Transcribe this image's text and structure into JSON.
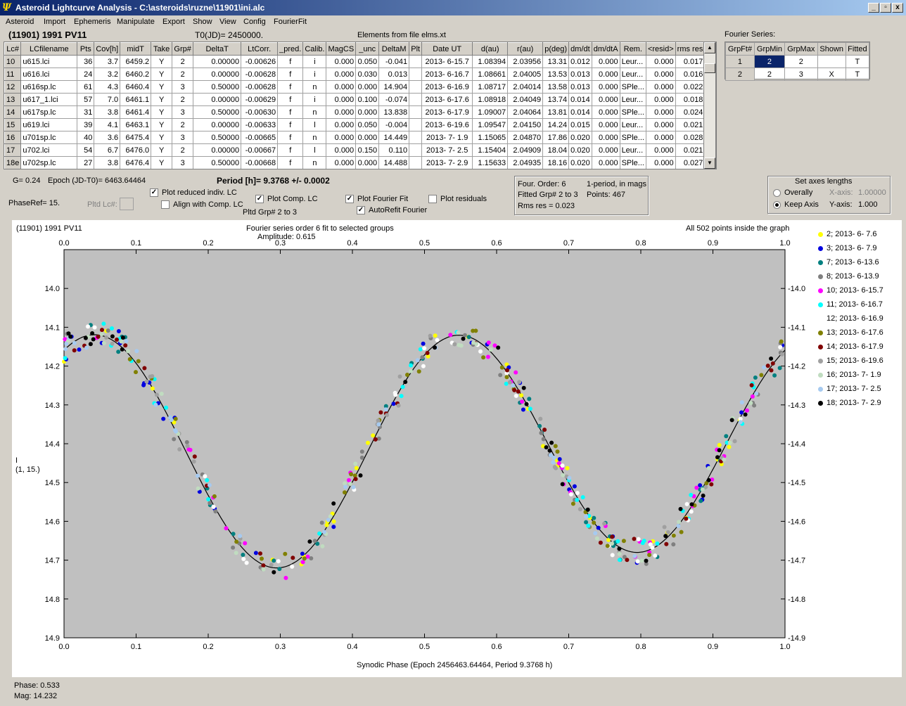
{
  "window": {
    "title": "Asteroid Lightcurve Analysis - C:\\asteroids\\ruzne\\11901\\ini.alc",
    "min": "_",
    "max": "▫",
    "close": "x"
  },
  "menu": [
    "Asteroid",
    "Import",
    "Ephemeris",
    "Manipulate",
    "Export",
    "Show",
    "View",
    "Config",
    "FourierFit"
  ],
  "header": {
    "object": "(11901) 1991 PV11",
    "t0": "T0(JD)= 2450000.",
    "elements": "Elements from file elms.xt"
  },
  "grid": {
    "columns": [
      "Lc#",
      "LCfilename",
      "Pts",
      "Cov[h]",
      "midT",
      "Take",
      "Grp#",
      "DeltaT",
      "LtCorr.",
      "_pred.",
      "Calib.",
      "MagCS",
      "_unc",
      "DeltaM",
      "Plt",
      "Date UT",
      "d(au)",
      "r(au)",
      "p(deg)",
      "dm/dt",
      "dm/dtA",
      "Rem.",
      "<resid>",
      "rms res"
    ],
    "rows": [
      [
        "10",
        "u615.lci",
        "36",
        "3.7",
        "6459.2",
        "Y",
        "2",
        "0.00000",
        "-0.00626",
        "f",
        "i",
        "0.000",
        "0.050",
        "-0.041",
        "",
        "2013- 6-15.7",
        "1.08394",
        "2.03956",
        "13.31",
        "0.012",
        "0.000",
        "Leur...",
        "0.000",
        "0.017"
      ],
      [
        "11",
        "u616.lci",
        "24",
        "3.2",
        "6460.2",
        "Y",
        "2",
        "0.00000",
        "-0.00628",
        "f",
        "i",
        "0.000",
        "0.030",
        "0.013",
        "",
        "2013- 6-16.7",
        "1.08661",
        "2.04005",
        "13.53",
        "0.013",
        "0.000",
        "Leur...",
        "0.000",
        "0.016"
      ],
      [
        "12",
        "u616sp.lc",
        "61",
        "4.3",
        "6460.4",
        "Y",
        "3",
        "0.50000",
        "-0.00628",
        "f",
        "n",
        "0.000",
        "0.000",
        "14.904",
        "",
        "2013- 6-16.9",
        "1.08717",
        "2.04014",
        "13.58",
        "0.013",
        "0.000",
        "SPle...",
        "0.000",
        "0.022"
      ],
      [
        "13",
        "u617_1.lci",
        "57",
        "7.0",
        "6461.1",
        "Y",
        "2",
        "0.00000",
        "-0.00629",
        "f",
        "i",
        "0.000",
        "0.100",
        "-0.074",
        "",
        "2013- 6-17.6",
        "1.08918",
        "2.04049",
        "13.74",
        "0.014",
        "0.000",
        "Leur...",
        "0.000",
        "0.018"
      ],
      [
        "14",
        "u617sp.lc",
        "31",
        "3.8",
        "6461.4",
        "Y",
        "3",
        "0.50000",
        "-0.00630",
        "f",
        "n",
        "0.000",
        "0.000",
        "13.838",
        "",
        "2013- 6-17.9",
        "1.09007",
        "2.04064",
        "13.81",
        "0.014",
        "0.000",
        "SPle...",
        "0.000",
        "0.024"
      ],
      [
        "15",
        "u619.lci",
        "39",
        "4.1",
        "6463.1",
        "Y",
        "2",
        "0.00000",
        "-0.00633",
        "f",
        "l",
        "0.000",
        "0.050",
        "-0.004",
        "",
        "2013- 6-19.6",
        "1.09547",
        "2.04150",
        "14.24",
        "0.015",
        "0.000",
        "Leur...",
        "0.000",
        "0.021"
      ],
      [
        "16",
        "u701sp.lc",
        "40",
        "3.6",
        "6475.4",
        "Y",
        "3",
        "0.50000",
        "-0.00665",
        "f",
        "n",
        "0.000",
        "0.000",
        "14.449",
        "",
        "2013- 7- 1.9",
        "1.15065",
        "2.04870",
        "17.86",
        "0.020",
        "0.000",
        "SPle...",
        "0.000",
        "0.028"
      ],
      [
        "17",
        "u702.lci",
        "54",
        "6.7",
        "6476.0",
        "Y",
        "2",
        "0.00000",
        "-0.00667",
        "f",
        "l",
        "0.000",
        "0.150",
        "0.110",
        "",
        "2013- 7- 2.5",
        "1.15404",
        "2.04909",
        "18.04",
        "0.020",
        "0.000",
        "Leur...",
        "0.000",
        "0.021"
      ],
      [
        "18e",
        "u702sp.lc",
        "27",
        "3.8",
        "6476.4",
        "Y",
        "3",
        "0.50000",
        "-0.00668",
        "f",
        "n",
        "0.000",
        "0.000",
        "14.488",
        "",
        "2013- 7- 2.9",
        "1.15633",
        "2.04935",
        "18.16",
        "0.020",
        "0.000",
        "SPle...",
        "0.000",
        "0.027"
      ]
    ]
  },
  "fourier_series": {
    "label": "Fourier Series:",
    "columns": [
      "GrpFt#",
      "GrpMin",
      "GrpMax",
      "Shown",
      "Fitted"
    ],
    "rows": [
      [
        "1",
        "2",
        "2",
        "",
        "T"
      ],
      [
        "2",
        "2",
        "3",
        "X",
        "T"
      ]
    ]
  },
  "controls": {
    "g": "G= 0.24",
    "epoch": "Epoch (JD-T0)= 6463.64464",
    "period": "Period [h]= 9.3768 +/- 0.0002",
    "phase_ref": "PhaseRef= 15.",
    "pltd_lc": "Pltd Lc#:",
    "plot_reduced": "Plot reduced indiv. LC",
    "align_comp": "Align with Comp. LC",
    "plot_comp": "Plot Comp. LC",
    "pltd_grp": "Pltd Grp#  2  to  3",
    "plot_fourier": "Plot Fourier Fit",
    "autorefit": "AutoRefit Fourier",
    "plot_residuals": "Plot residuals",
    "four_order": "Four. Order:  6",
    "one_period": "1-period, in mags",
    "fitted_grp": "Fitted Grp# 2 to 3",
    "points": "Points: 467",
    "rms": "Rms res     = 0.023",
    "axes_title": "Set axes lengths",
    "overally": "Overally",
    "keep_axis": "Keep Axis",
    "xaxis_label": "X-axis:",
    "xaxis_val": "1.00000",
    "yaxis_label": "Y-axis:",
    "yaxis_val": "1.000"
  },
  "status": {
    "phase": "Phase:  0.533",
    "mag": "Mag:   14.232"
  },
  "chart_data": {
    "type": "scatter",
    "title": "Fourier series order 6 fit to selected groups",
    "subtitle": "Amplitude: 0.615",
    "object": "(11901) 1991 PV11",
    "points_note": "All 502 points inside the graph",
    "xlabel": "Synodic Phase (Epoch 2456463.64464, Period 9.3768 h)",
    "ylabel": "I",
    "ylabel2": "(1, 15.)",
    "xlim": [
      0,
      1
    ],
    "ylim": [
      14.9,
      13.9
    ],
    "xticks": [
      "0.0",
      "0.1",
      "0.2",
      "0.3",
      "0.4",
      "0.5",
      "0.6",
      "0.7",
      "0.8",
      "0.9",
      "1.0"
    ],
    "yticks": [
      "14.0",
      "14.1",
      "14.2",
      "14.3",
      "14.4",
      "14.5",
      "14.6",
      "14.7",
      "14.8",
      "14.9"
    ],
    "fit": {
      "mean": 14.41,
      "minima_phases": [
        0.295,
        0.795
      ],
      "maxima_phases": [
        0.03,
        0.54
      ],
      "amplitude": 0.615
    },
    "series": [
      {
        "name": "2; 2013- 6- 7.6",
        "color": "#ffff00"
      },
      {
        "name": "3; 2013- 6- 7.9",
        "color": "#0000e0"
      },
      {
        "name": "7; 2013- 6-13.6",
        "color": "#008080"
      },
      {
        "name": "8; 2013- 6-13.9",
        "color": "#808080"
      },
      {
        "name": "10; 2013- 6-15.7",
        "color": "#ff00ff"
      },
      {
        "name": "11; 2013- 6-16.7",
        "color": "#00ffff"
      },
      {
        "name": "12; 2013- 6-16.9",
        "color": "#ffffff"
      },
      {
        "name": "13; 2013- 6-17.6",
        "color": "#808000"
      },
      {
        "name": "14; 2013- 6-17.9",
        "color": "#800000"
      },
      {
        "name": "15; 2013- 6-19.6",
        "color": "#a0a0a0"
      },
      {
        "name": "16; 2013- 7- 1.9",
        "color": "#c0dcc0"
      },
      {
        "name": "17; 2013- 7- 2.5",
        "color": "#a6caf0"
      },
      {
        "name": "18; 2013- 7- 2.9",
        "color": "#000000"
      }
    ]
  }
}
